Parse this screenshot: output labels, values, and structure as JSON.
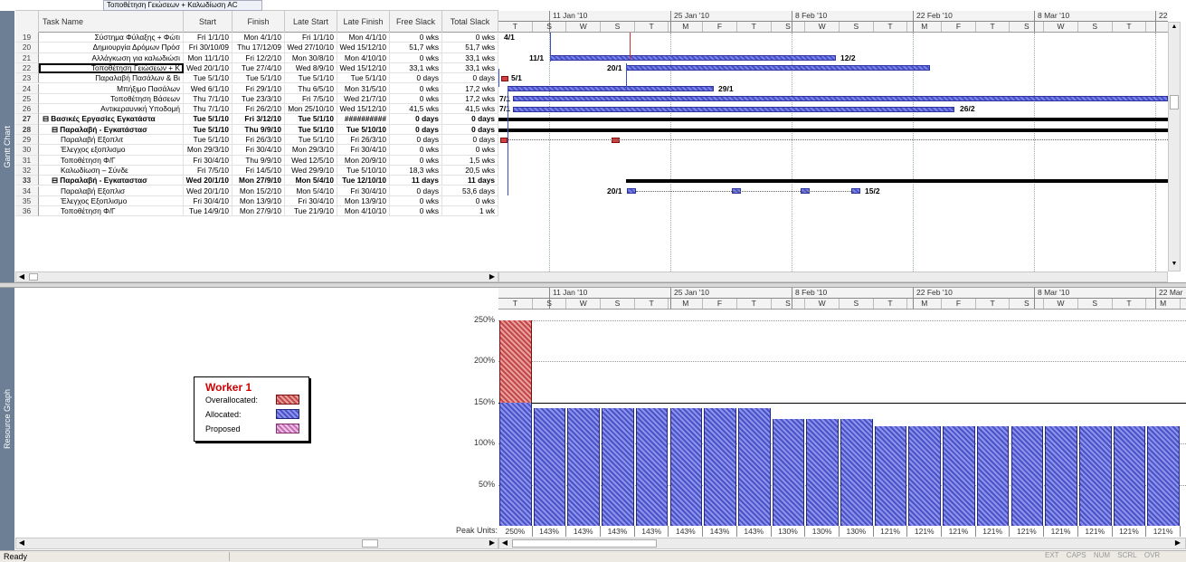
{
  "entry_bar": {
    "value": "Τοποθέτηση Γειώσεων + Καλωδίωση AC"
  },
  "views": {
    "top": "Gantt Chart",
    "bottom": "Resource Graph"
  },
  "columns": [
    "Task Name",
    "Start",
    "Finish",
    "Late Start",
    "Late Finish",
    "Free Slack",
    "Total Slack"
  ],
  "rows": [
    {
      "id": "19",
      "name": "Σύστημα Φύλαξης + Φώτι",
      "start": "Fri 1/1/10",
      "finish": "Mon 4/1/10",
      "ls": "Fri 1/1/10",
      "lf": "Mon 4/1/10",
      "fs": "0 wks",
      "ts": "0 wks",
      "indent": 0,
      "bold": false
    },
    {
      "id": "20",
      "name": "Δημιουργία Δρόμων Πρόσ",
      "start": "Fri 30/10/09",
      "finish": "Thu 17/12/09",
      "ls": "Wed 27/10/10",
      "lf": "Wed 15/12/10",
      "fs": "51,7 wks",
      "ts": "51,7 wks",
      "indent": 0,
      "bold": false
    },
    {
      "id": "21",
      "name": "Αλλάγκωση για καλωδιώσι",
      "start": "Mon 11/1/10",
      "finish": "Fri 12/2/10",
      "ls": "Mon 30/8/10",
      "lf": "Mon 4/10/10",
      "fs": "0 wks",
      "ts": "33,1 wks",
      "indent": 0,
      "bold": false
    },
    {
      "id": "22",
      "name": "Τοποθέτηση Γειώσεων + Κ",
      "start": "Wed 20/1/10",
      "finish": "Tue 27/4/10",
      "ls": "Wed 8/9/10",
      "lf": "Wed 15/12/10",
      "fs": "33,1 wks",
      "ts": "33,1 wks",
      "indent": 0,
      "bold": false
    },
    {
      "id": "23",
      "name": "Παραλαβή Πασάλων & Βι",
      "start": "Tue 5/1/10",
      "finish": "Tue 5/1/10",
      "ls": "Tue 5/1/10",
      "lf": "Tue 5/1/10",
      "fs": "0 days",
      "ts": "0 days",
      "indent": 0,
      "bold": false
    },
    {
      "id": "24",
      "name": "Μπήξιμο Πασάλων",
      "start": "Wed 6/1/10",
      "finish": "Fri 29/1/10",
      "ls": "Thu 6/5/10",
      "lf": "Mon 31/5/10",
      "fs": "0 wks",
      "ts": "17,2 wks",
      "indent": 0,
      "bold": false
    },
    {
      "id": "25",
      "name": "Τοποθέτηση Βάσεων",
      "start": "Thu 7/1/10",
      "finish": "Tue 23/3/10",
      "ls": "Fri 7/5/10",
      "lf": "Wed 21/7/10",
      "fs": "0 wks",
      "ts": "17,2 wks",
      "indent": 0,
      "bold": false
    },
    {
      "id": "26",
      "name": "Αντικεραυνική Υποδομή",
      "start": "Thu 7/1/10",
      "finish": "Fri 26/2/10",
      "ls": "Mon 25/10/10",
      "lf": "Wed 15/12/10",
      "fs": "41,5 wks",
      "ts": "41,5 wks",
      "indent": 0,
      "bold": false
    },
    {
      "id": "27",
      "name": "⊟ Βασικές Εργασίες Εγκατάστα",
      "start": "Tue 5/1/10",
      "finish": "Fri 3/12/10",
      "ls": "Tue 5/1/10",
      "lf": "##########",
      "fs": "0 days",
      "ts": "0 days",
      "indent": 0,
      "bold": true
    },
    {
      "id": "28",
      "name": "⊟ Παραλαβή - Εγκατάστασ",
      "start": "Tue 5/1/10",
      "finish": "Thu 9/9/10",
      "ls": "Tue 5/1/10",
      "lf": "Tue 5/10/10",
      "fs": "0 days",
      "ts": "0 days",
      "indent": 1,
      "bold": true
    },
    {
      "id": "29",
      "name": "Παραλαβή Εξοπλιτ",
      "start": "Tue 5/1/10",
      "finish": "Fri 26/3/10",
      "ls": "Tue 5/1/10",
      "lf": "Fri 26/3/10",
      "fs": "0 days",
      "ts": "0 days",
      "indent": 2,
      "bold": false
    },
    {
      "id": "30",
      "name": "Έλεγχος εξοπλισμο",
      "start": "Mon 29/3/10",
      "finish": "Fri 30/4/10",
      "ls": "Mon 29/3/10",
      "lf": "Fri 30/4/10",
      "fs": "0 wks",
      "ts": "0 wks",
      "indent": 2,
      "bold": false
    },
    {
      "id": "31",
      "name": "Τοποθέτηση Φ/Γ",
      "start": "Fri 30/4/10",
      "finish": "Thu 9/9/10",
      "ls": "Wed 12/5/10",
      "lf": "Mon 20/9/10",
      "fs": "0 wks",
      "ts": "1,5 wks",
      "indent": 2,
      "bold": false
    },
    {
      "id": "32",
      "name": "Καλωδίωση – Σύνδε",
      "start": "Fri 7/5/10",
      "finish": "Fri 14/5/10",
      "ls": "Wed 29/9/10",
      "lf": "Tue 5/10/10",
      "fs": "18,3 wks",
      "ts": "20,5 wks",
      "indent": 2,
      "bold": false
    },
    {
      "id": "33",
      "name": "⊟ Παραλαβή - Εγκαταστασ",
      "start": "Wed 20/1/10",
      "finish": "Mon 27/9/10",
      "ls": "Mon 5/4/10",
      "lf": "Tue 12/10/10",
      "fs": "11 days",
      "ts": "11 days",
      "indent": 1,
      "bold": true
    },
    {
      "id": "34",
      "name": "Παραλαβή Εξοπλισ",
      "start": "Wed 20/1/10",
      "finish": "Mon 15/2/10",
      "ls": "Mon 5/4/10",
      "lf": "Fri 30/4/10",
      "fs": "0 days",
      "ts": "53,6 days",
      "indent": 2,
      "bold": false
    },
    {
      "id": "35",
      "name": "Έλεγχος Εξοπλισμο",
      "start": "Fri 30/4/10",
      "finish": "Mon 13/9/10",
      "ls": "Fri 30/4/10",
      "lf": "Mon 13/9/10",
      "fs": "0 wks",
      "ts": "0 wks",
      "indent": 2,
      "bold": false
    },
    {
      "id": "36",
      "name": "Τοποθέτηση Φ/Γ",
      "start": "Tue 14/9/10",
      "finish": "Mon 27/9/10",
      "ls": "Tue 21/9/10",
      "lf": "Mon 4/10/10",
      "fs": "0 wks",
      "ts": "1 wk",
      "indent": 2,
      "bold": false
    }
  ],
  "timescale": {
    "major": [
      "11 Jan '10",
      "25 Jan '10",
      "8 Feb '10",
      "22 Feb '10",
      "8 Mar '10",
      "22"
    ],
    "minor": [
      "T",
      "S",
      "W",
      "S",
      "T",
      "M",
      "F",
      "T",
      "S",
      "W",
      "S",
      "T",
      "M",
      "F",
      "T",
      "S",
      "W",
      "S",
      "T"
    ]
  },
  "bottom_timescale": {
    "major": [
      "11 Jan '10",
      "25 Jan '10",
      "8 Feb '10",
      "22 Feb '10",
      "8 Mar '10",
      "22 Mar"
    ],
    "minor": [
      "T",
      "S",
      "W",
      "S",
      "T",
      "M",
      "F",
      "T",
      "S",
      "W",
      "S",
      "T",
      "M",
      "F",
      "T",
      "S",
      "W",
      "S",
      "T",
      "M"
    ]
  },
  "gantt_labels": {
    "r19": "4/1",
    "r21s": "11/1",
    "r21e": "12/2",
    "r22s": "20/1",
    "r23": "5/1",
    "r24e": "29/1",
    "r25s": "7/1",
    "r26s": "7/1",
    "r26e": "26/2",
    "r34s": "20/1",
    "r34e": "15/2"
  },
  "legend": {
    "title": "Worker 1",
    "overallocated": "Overallocated:",
    "allocated": "Allocated:",
    "proposed": "Proposed"
  },
  "graph": {
    "y_ticks": [
      "250%",
      "200%",
      "150%",
      "100%",
      "50%"
    ],
    "peak_label": "Peak Units:",
    "peaks": [
      250,
      143,
      143,
      143,
      143,
      143,
      143,
      143,
      130,
      130,
      130,
      121,
      121,
      121,
      121,
      121,
      121,
      121,
      121,
      121
    ],
    "peak_labels": [
      "250%",
      "143%",
      "143%",
      "143%",
      "143%",
      "143%",
      "143%",
      "143%",
      "130%",
      "130%",
      "130%",
      "121%",
      "121%",
      "121%",
      "121%",
      "121%",
      "121%",
      "121%",
      "121%",
      "121%"
    ],
    "max_units": 150,
    "colors": {
      "overallocated": "#d96060",
      "allocated": "#5057cc"
    }
  },
  "status": {
    "ready": "Ready",
    "ind": [
      "EXT",
      "CAPS",
      "NUM",
      "SCRL",
      "OVR"
    ]
  }
}
